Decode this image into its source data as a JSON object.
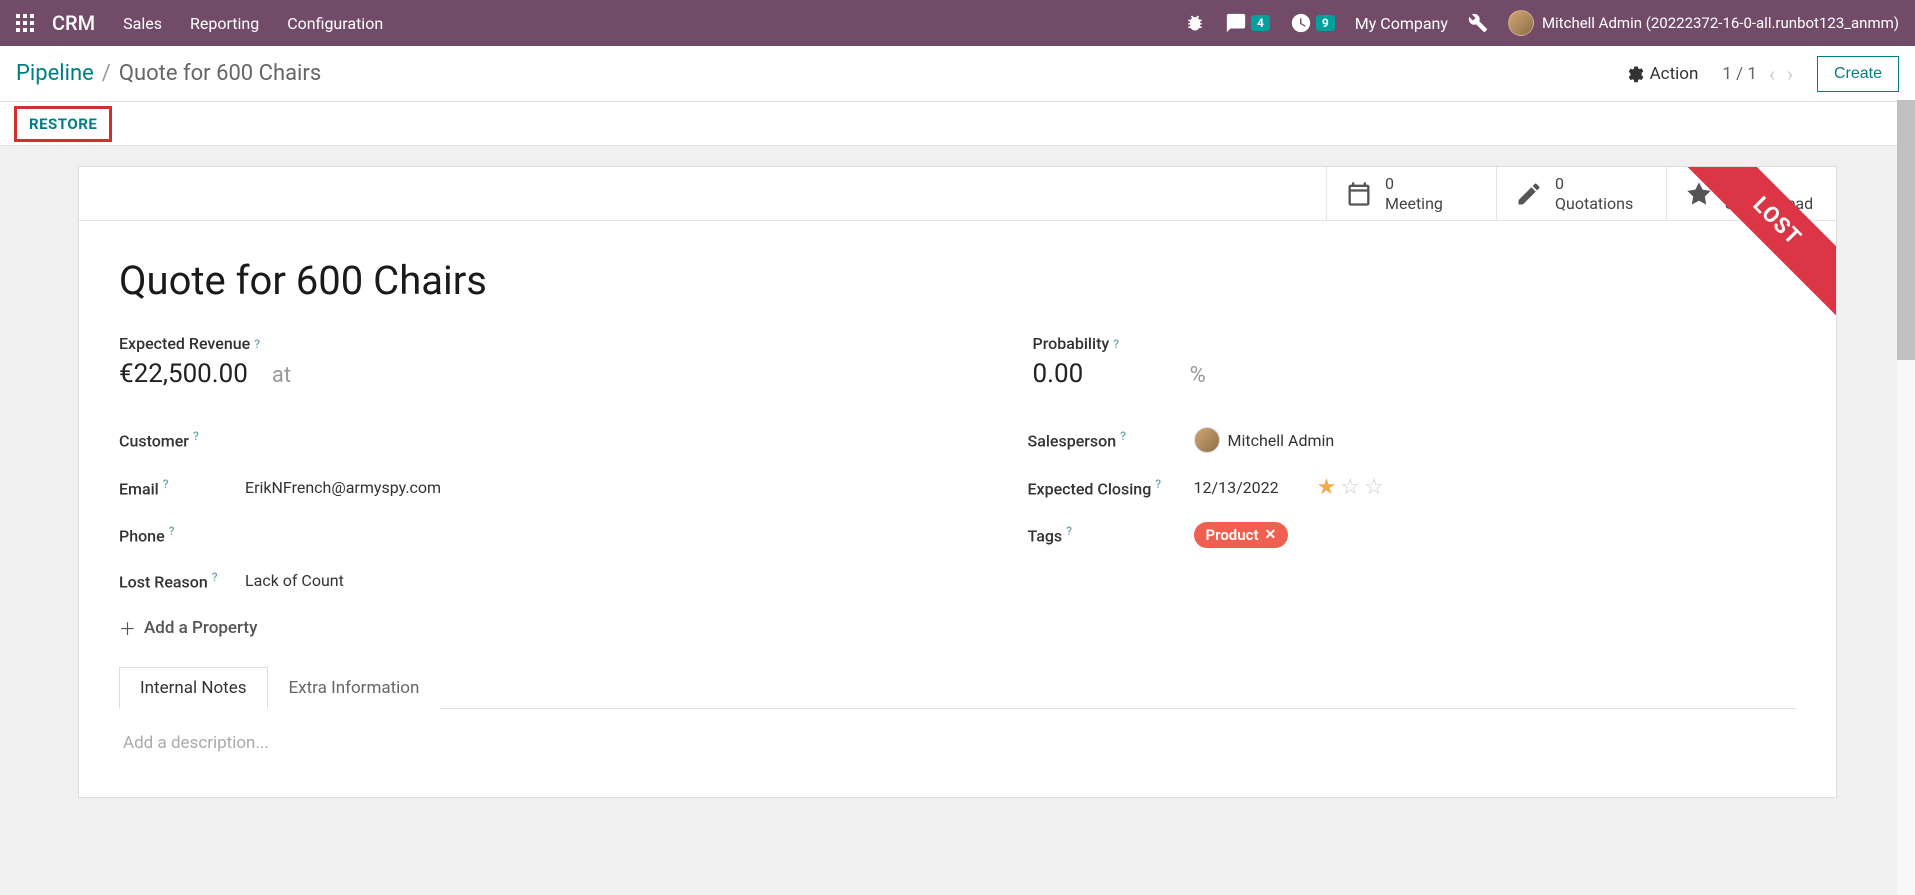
{
  "topbar": {
    "brand": "CRM",
    "nav": [
      "Sales",
      "Reporting",
      "Configuration"
    ],
    "msgCount": "4",
    "activityCount": "9",
    "company": "My Company",
    "user": "Mitchell Admin (20222372-16-0-all.runbot123_anmm)"
  },
  "breadcrumb": {
    "root": "Pipeline",
    "current": "Quote for 600 Chairs",
    "action": "Action",
    "pager": "1 / 1",
    "create": "Create"
  },
  "restore": "RESTORE",
  "stats": {
    "meeting": {
      "count": "0",
      "label": "Meeting"
    },
    "quotations": {
      "count": "0",
      "label": "Quotations"
    },
    "similar": {
      "count": "1",
      "label": "Similar Lead"
    }
  },
  "ribbon": "LOST",
  "record": {
    "title": "Quote for 600 Chairs",
    "expectedRevenueLabel": "Expected Revenue",
    "expectedRevenue": "€22,500.00",
    "at": "at",
    "probabilityLabel": "Probability",
    "probability": "0.00",
    "pct": "%",
    "customerLabel": "Customer",
    "customer": "",
    "emailLabel": "Email",
    "email": "ErikNFrench@armyspy.com",
    "phoneLabel": "Phone",
    "phone": "",
    "lostReasonLabel": "Lost Reason",
    "lostReason": "Lack of Count",
    "salespersonLabel": "Salesperson",
    "salesperson": "Mitchell Admin",
    "expectedClosingLabel": "Expected Closing",
    "expectedClosing": "12/13/2022",
    "tagsLabel": "Tags",
    "tag": "Product",
    "addProperty": "Add a Property"
  },
  "tabs": {
    "internal": "Internal Notes",
    "extra": "Extra Information",
    "placeholder": "Add a description..."
  }
}
